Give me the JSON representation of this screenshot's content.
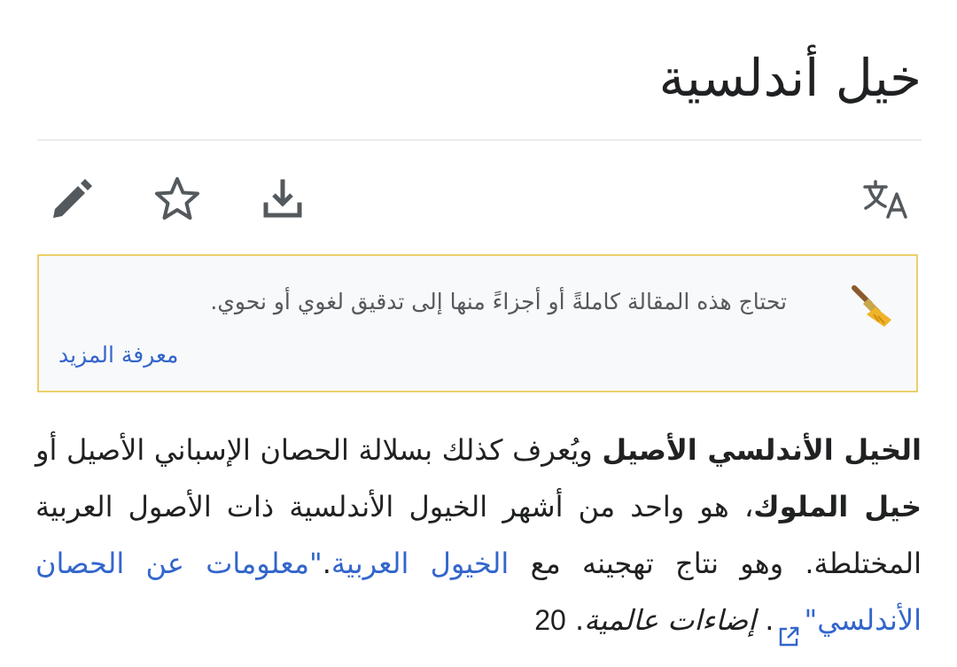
{
  "article": {
    "title": "خيل أندلسية"
  },
  "toolbar": {
    "language_icon": "language-translate-icon",
    "download_icon": "download-icon",
    "watch_icon": "star-icon",
    "edit_icon": "pencil-icon"
  },
  "notice": {
    "icon": "broom-icon",
    "text": "تحتاج هذه المقالة كاملةً أو أجزاءً منها إلى تدقيق لغوي أو نحوي.",
    "link": "معرفة المزيد",
    "border_color": "#eccf6a",
    "background_color": "#f8f9fa"
  },
  "body": {
    "bold1": "الخيل الأندلسي الأصيل",
    "text1": " ويُعرف كذلك بسلالة الحصان الإسباني الأصيل أو ",
    "bold2": "خيل الملوك",
    "text2": "، هو واحد من أشهر الخيول الأندلسية ذات الأصول العربية المختلطة. وهو نتاج تهجينه مع ",
    "link1": "الخيول العربية",
    "text3": ".",
    "link2": "\"معلومات عن الحصان الأندلسي\"",
    "text4": ". ",
    "italic1": "إضاءات عالمية",
    "text5": ". ",
    "number": "20"
  },
  "colors": {
    "link": "#3366cc",
    "text": "#202122",
    "muted": "#54595d",
    "icon": "#54595d"
  }
}
